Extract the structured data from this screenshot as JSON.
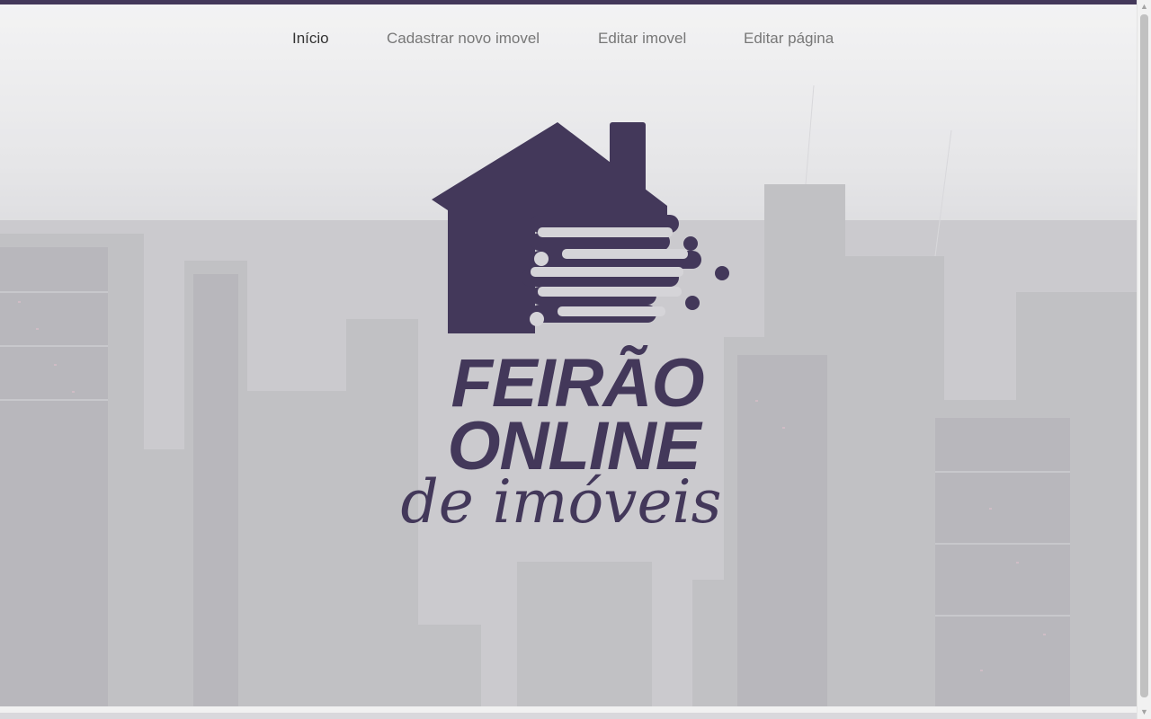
{
  "nav": {
    "items": [
      {
        "label": "Início",
        "active": true
      },
      {
        "label": "Cadastrar novo imovel",
        "active": false
      },
      {
        "label": "Editar imovel",
        "active": false
      },
      {
        "label": "Editar página",
        "active": false
      }
    ]
  },
  "logo": {
    "line1": "FEIRÃO",
    "line2": "ONLINE",
    "line3": "de imóveis",
    "icon": "house-icon"
  },
  "colors": {
    "brand": "#43385a",
    "nav_active": "#333333",
    "nav_inactive": "#777777"
  },
  "background": {
    "icon": "city-skyline-photo"
  },
  "scrollbar": {
    "up_icon": "▲",
    "down_icon": "▼"
  }
}
